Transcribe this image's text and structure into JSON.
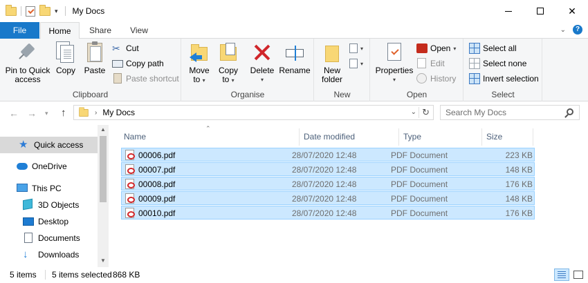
{
  "window": {
    "title": "My Docs",
    "controls": {
      "minimize": "",
      "maximize": "",
      "close": "✕"
    }
  },
  "tabs": {
    "file": "File",
    "home": "Home",
    "share": "Share",
    "view": "View",
    "help": "?"
  },
  "ribbon": {
    "clipboard": {
      "label": "Clipboard",
      "pin_line1": "Pin to Quick",
      "pin_line2": "access",
      "copy": "Copy",
      "paste": "Paste",
      "cut": "Cut",
      "copy_path": "Copy path",
      "paste_shortcut": "Paste shortcut"
    },
    "organise": {
      "label": "Organise",
      "move_line1": "Move",
      "move_line2": "to",
      "copy_line1": "Copy",
      "copy_line2": "to",
      "delete": "Delete",
      "rename": "Rename"
    },
    "new": {
      "label": "New",
      "new_folder_line1": "New",
      "new_folder_line2": "folder"
    },
    "open": {
      "label": "Open",
      "properties": "Properties",
      "open": "Open",
      "edit": "Edit",
      "history": "History"
    },
    "select": {
      "label": "Select",
      "select_all": "Select all",
      "select_none": "Select none",
      "invert": "Invert selection"
    }
  },
  "address": {
    "path": "My Docs",
    "search_placeholder": "Search My Docs"
  },
  "nav": {
    "items": [
      {
        "label": "Quick access",
        "icon": "star-icon",
        "selected": true
      },
      {
        "label": "OneDrive",
        "icon": "cloud-icon"
      },
      {
        "label": "This PC",
        "icon": "computer-icon"
      },
      {
        "label": "3D Objects",
        "icon": "cube-icon"
      },
      {
        "label": "Desktop",
        "icon": "desktop-icon"
      },
      {
        "label": "Documents",
        "icon": "documents-icon"
      },
      {
        "label": "Downloads",
        "icon": "download-arrow-icon"
      }
    ]
  },
  "columns": {
    "name": "Name",
    "date": "Date modified",
    "type": "Type",
    "size": "Size"
  },
  "files": [
    {
      "name": "00006.pdf",
      "date": "28/07/2020 12:48",
      "type": "PDF Document",
      "size": "223 KB"
    },
    {
      "name": "00007.pdf",
      "date": "28/07/2020 12:48",
      "type": "PDF Document",
      "size": "148 KB"
    },
    {
      "name": "00008.pdf",
      "date": "28/07/2020 12:48",
      "type": "PDF Document",
      "size": "176 KB"
    },
    {
      "name": "00009.pdf",
      "date": "28/07/2020 12:48",
      "type": "PDF Document",
      "size": "148 KB"
    },
    {
      "name": "00010.pdf",
      "date": "28/07/2020 12:48",
      "type": "PDF Document",
      "size": "176 KB"
    }
  ],
  "status": {
    "count": "5 items",
    "selected": "5 items selected",
    "selected_size": "868 KB"
  },
  "colors": {
    "accent": "#1979ca",
    "selection": "#cce8ff",
    "selection_border": "#99d1ff"
  }
}
